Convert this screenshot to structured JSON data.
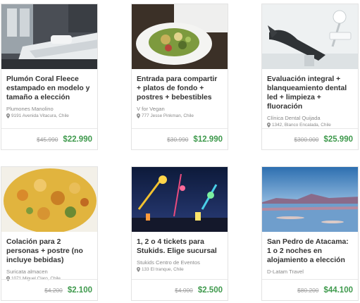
{
  "deals": [
    {
      "title": "Plumón Coral Fleece estampado en modelo y tamaño a elección",
      "merchant": "Plumones Manolino",
      "address": "9191 Avenida Vitacura, Chile",
      "old_price": "$45.990",
      "price": "$22.990"
    },
    {
      "title": "Entrada para compartir + platos de fondo + postres + bebestibles",
      "merchant": "V for Vegan",
      "address": "777 Jesse Pinkman, Chile",
      "old_price": "$30.990",
      "price": "$12.990"
    },
    {
      "title": "Evaluación integral + blanqueamiento dental led + limpieza + fluoración",
      "merchant": "Clínica Dental Quijada",
      "address": "1342, Blanco Encalada, Chile",
      "old_price": "$300.000",
      "price": "$25.990"
    },
    {
      "title": "Colación para 2 personas + postre (no incluye bebidas)",
      "merchant": "Suricata almacen",
      "address": "1071 Miguel Claro, Chile",
      "old_price": "$4.200",
      "price": "$2.100"
    },
    {
      "title": "1, 2 o 4 tickets para Stukids. Elige sucursal",
      "merchant": "Stukids Centro de Eventos",
      "address": "133 El tranque, Chile",
      "old_price": "$4.000",
      "price": "$2.500"
    },
    {
      "title": "San Pedro de Atacama: 1 o 2 noches en alojamiento a elección",
      "merchant": "D-Latam Travel",
      "address": "",
      "old_price": "$80.200",
      "price": "$44.100"
    }
  ],
  "colors": {
    "price_green": "#3f9a4d",
    "border": "#e3e3e3"
  }
}
